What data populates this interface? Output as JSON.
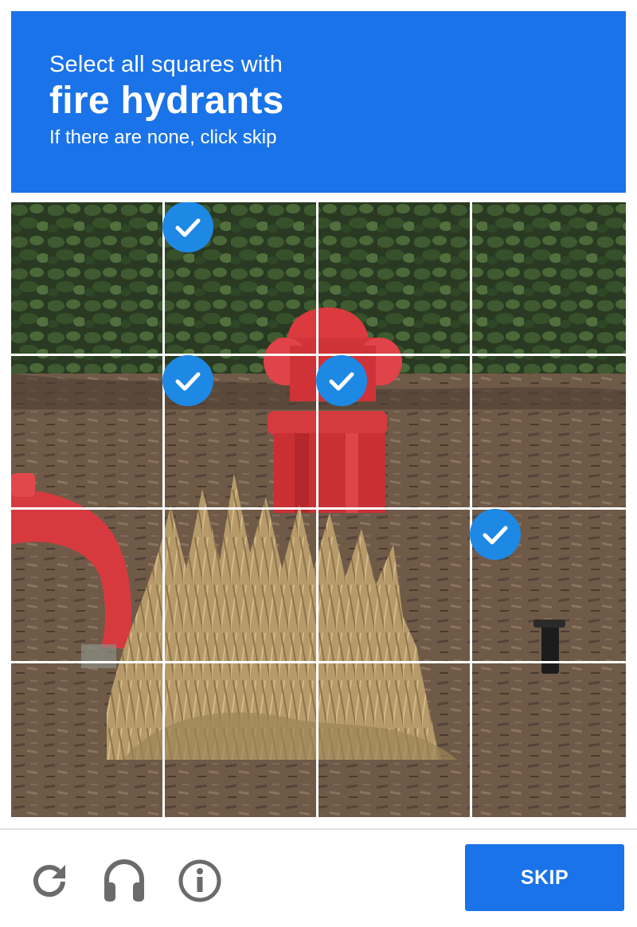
{
  "header": {
    "instruction": "Select all squares with",
    "target": "fire hydrants",
    "hint": "If there are none, click skip"
  },
  "grid": {
    "rows": 4,
    "cols": 4,
    "selected": [
      [
        0,
        1
      ],
      [
        1,
        1
      ],
      [
        1,
        2
      ],
      [
        2,
        3
      ]
    ]
  },
  "footer": {
    "reload_icon": "reload-icon",
    "audio_icon": "headphones-icon",
    "info_icon": "info-icon",
    "skip_label": "SKIP"
  },
  "colors": {
    "accent": "#1a73e8",
    "check": "#1e88e5",
    "icon": "#6b6b6b"
  }
}
